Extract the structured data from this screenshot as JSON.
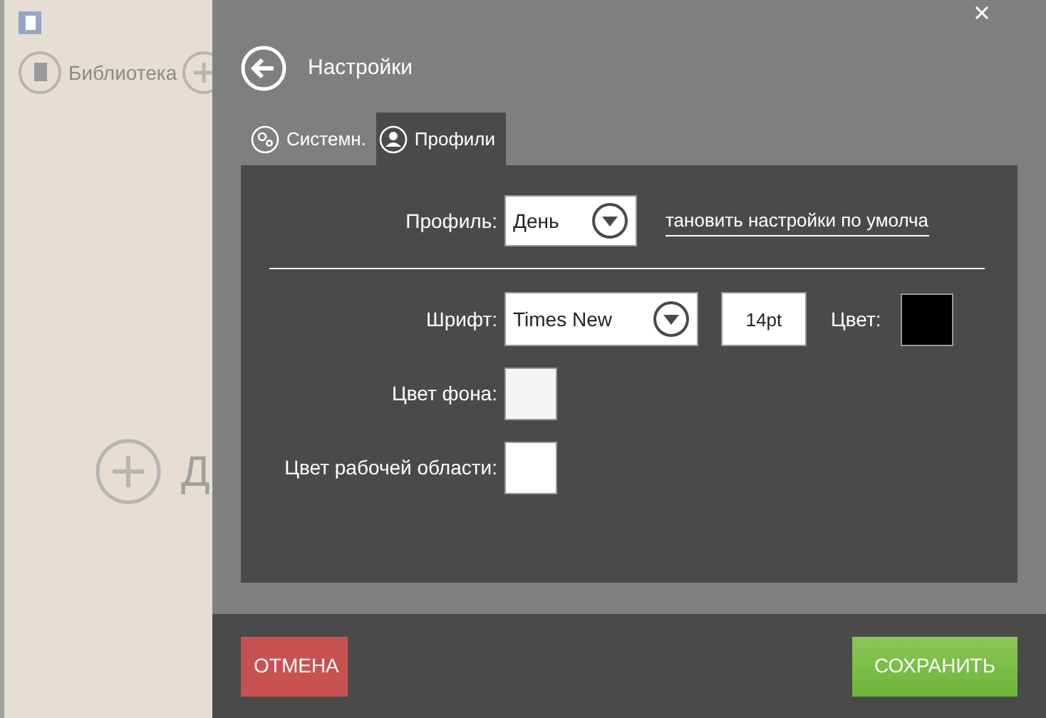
{
  "background": {
    "nav_items": [
      {
        "label": "Библиотека"
      }
    ],
    "add_label": "Д"
  },
  "dialog": {
    "title": "Настройки",
    "tabs": [
      {
        "label": "Системн.",
        "kind": "gears",
        "selected": false
      },
      {
        "label": "Профили",
        "kind": "person",
        "selected": true
      }
    ],
    "profile": {
      "label": "Профиль:",
      "value": "День",
      "reset_link": "тановить настройки по умолча"
    },
    "font": {
      "label": "Шрифт:",
      "value": "Times New",
      "size": "14pt",
      "color_label": "Цвет:",
      "color": "#000000"
    },
    "colors": [
      {
        "label": "Цвет фона:",
        "color": "#f5f5f5"
      },
      {
        "label": "Цвет рабочей области:",
        "color": "#ffffff"
      }
    ],
    "buttons": [
      {
        "label": "ОТМЕНА",
        "kind": "cancel"
      },
      {
        "label": "СОХРАНИТЬ",
        "kind": "save"
      }
    ]
  }
}
